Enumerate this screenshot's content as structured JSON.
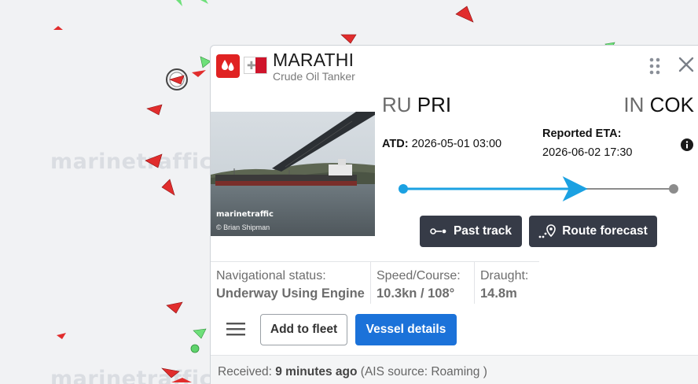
{
  "map": {
    "watermark": "marinetraffic"
  },
  "vessel": {
    "name": "MARATHI",
    "type": "Crude Oil Tanker",
    "flag_colors": {
      "white": "#ffffff",
      "red": "#cf142b"
    },
    "icon_color": "#e02222"
  },
  "photo": {
    "brand": "marinetraffic",
    "credit": "© Brian Shipman"
  },
  "voyage": {
    "from_country": "RU",
    "from_port": "PRI",
    "to_country": "IN",
    "to_port": "COK",
    "atd_label": "ATD:",
    "atd_value": "2026-05-01 03:00",
    "eta_label": "Reported ETA:",
    "eta_value": "2026-06-02 17:30",
    "progress": 0.63,
    "progress_color": "#1ba1e2"
  },
  "actions": {
    "past_track": "Past track",
    "route_forecast": "Route forecast",
    "add_to_fleet": "Add to fleet",
    "vessel_details": "Vessel details"
  },
  "status": {
    "nav_label": "Navigational status:",
    "nav_value": "Underway Using Engine",
    "speed_label": "Speed/Course:",
    "speed_value": "10.3kn / 108°",
    "draught_label": "Draught:",
    "draught_value": "14.8m"
  },
  "footer": {
    "received_label": "Received:",
    "received_value": "9 minutes ago",
    "source": "(AIS source: Roaming )"
  }
}
